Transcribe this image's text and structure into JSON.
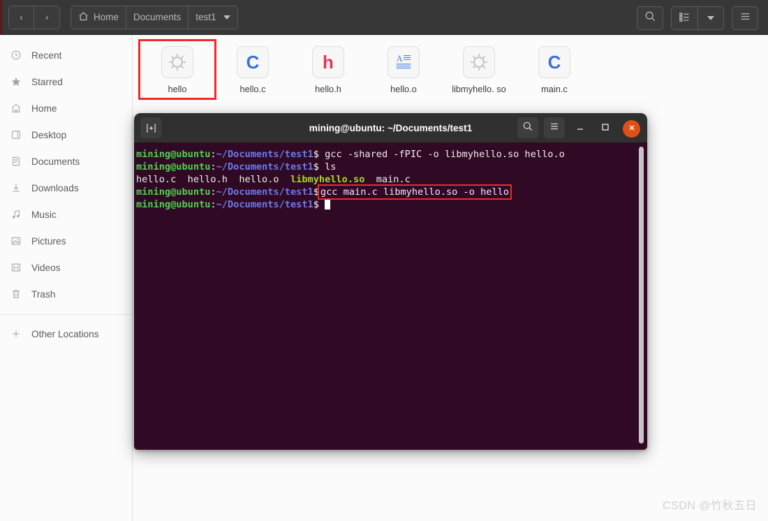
{
  "headerbar": {
    "nav": {
      "back_label": "‹",
      "forward_label": "›"
    },
    "breadcrumbs": [
      {
        "label": "Home",
        "icon": "home-icon"
      },
      {
        "label": "Documents",
        "icon": ""
      },
      {
        "label": "test1",
        "icon": "chevron-down-icon"
      }
    ],
    "actions": {
      "search": "search-icon",
      "view_list": "list-view-icon",
      "view_dropdown": "chevron-down-icon",
      "menu": "hamburger-menu-icon"
    }
  },
  "sidebar": {
    "items": [
      {
        "label": "Recent",
        "icon": "clock-icon"
      },
      {
        "label": "Starred",
        "icon": "star-icon"
      },
      {
        "label": "Home",
        "icon": "home-icon"
      },
      {
        "label": "Desktop",
        "icon": "desktop-icon"
      },
      {
        "label": "Documents",
        "icon": "document-icon"
      },
      {
        "label": "Downloads",
        "icon": "download-icon"
      },
      {
        "label": "Music",
        "icon": "music-note-icon"
      },
      {
        "label": "Pictures",
        "icon": "picture-icon"
      },
      {
        "label": "Videos",
        "icon": "film-icon"
      },
      {
        "label": "Trash",
        "icon": "trash-icon"
      }
    ],
    "other_locations": {
      "label": "Other Locations",
      "icon": "plus-icon"
    }
  },
  "files": [
    {
      "name": "hello",
      "icon": "gear-executable-icon",
      "selected": true
    },
    {
      "name": "hello.c",
      "icon": "c-source-icon",
      "selected": false
    },
    {
      "name": "hello.h",
      "icon": "h-header-icon",
      "selected": false
    },
    {
      "name": "hello.o",
      "icon": "text-document-icon",
      "selected": false
    },
    {
      "name": "libmyhello.\nso",
      "icon": "gear-executable-icon",
      "selected": false
    },
    {
      "name": "main.c",
      "icon": "c-source-icon",
      "selected": false
    }
  ],
  "terminal": {
    "title": "mining@ubuntu: ~/Documents/test1",
    "titlebar_icons": {
      "new_tab": "new-tab-icon",
      "search": "search-icon",
      "menu": "hamburger-menu-icon",
      "minimize": "minimize-icon",
      "maximize": "maximize-icon",
      "close": "close-icon"
    },
    "prompt": {
      "user": "mining@ubuntu",
      "colon": ":",
      "path": "~/Documents/test1",
      "dollar": "$"
    },
    "lines": [
      {
        "type": "prompt",
        "command": " gcc -shared -fPIC -o libmyhello.so hello.o",
        "highlight": false
      },
      {
        "type": "prompt",
        "command": " ls",
        "highlight": false
      },
      {
        "type": "output",
        "parts": [
          {
            "text": "hello.c  hello.h  hello.o  ",
            "color": "plain"
          },
          {
            "text": "libmyhello.so",
            "color": "so"
          },
          {
            "text": "  main.c",
            "color": "plain"
          }
        ]
      },
      {
        "type": "prompt",
        "command": "gcc main.c libmyhello.so -o hello",
        "highlight": true
      },
      {
        "type": "prompt",
        "command": "",
        "highlight": false,
        "cursor": true
      }
    ],
    "colors": {
      "background": "#300a24",
      "prompt_user": "#4fd14f",
      "prompt_path": "#6b7ae8",
      "text": "#eeeeee",
      "shared_object": "#a6d816",
      "highlight_box": "#ee2b2b",
      "titlebar": "#303030",
      "close_button": "#e24f16"
    }
  },
  "watermark": {
    "text": "CSDN @竹秋五日"
  }
}
